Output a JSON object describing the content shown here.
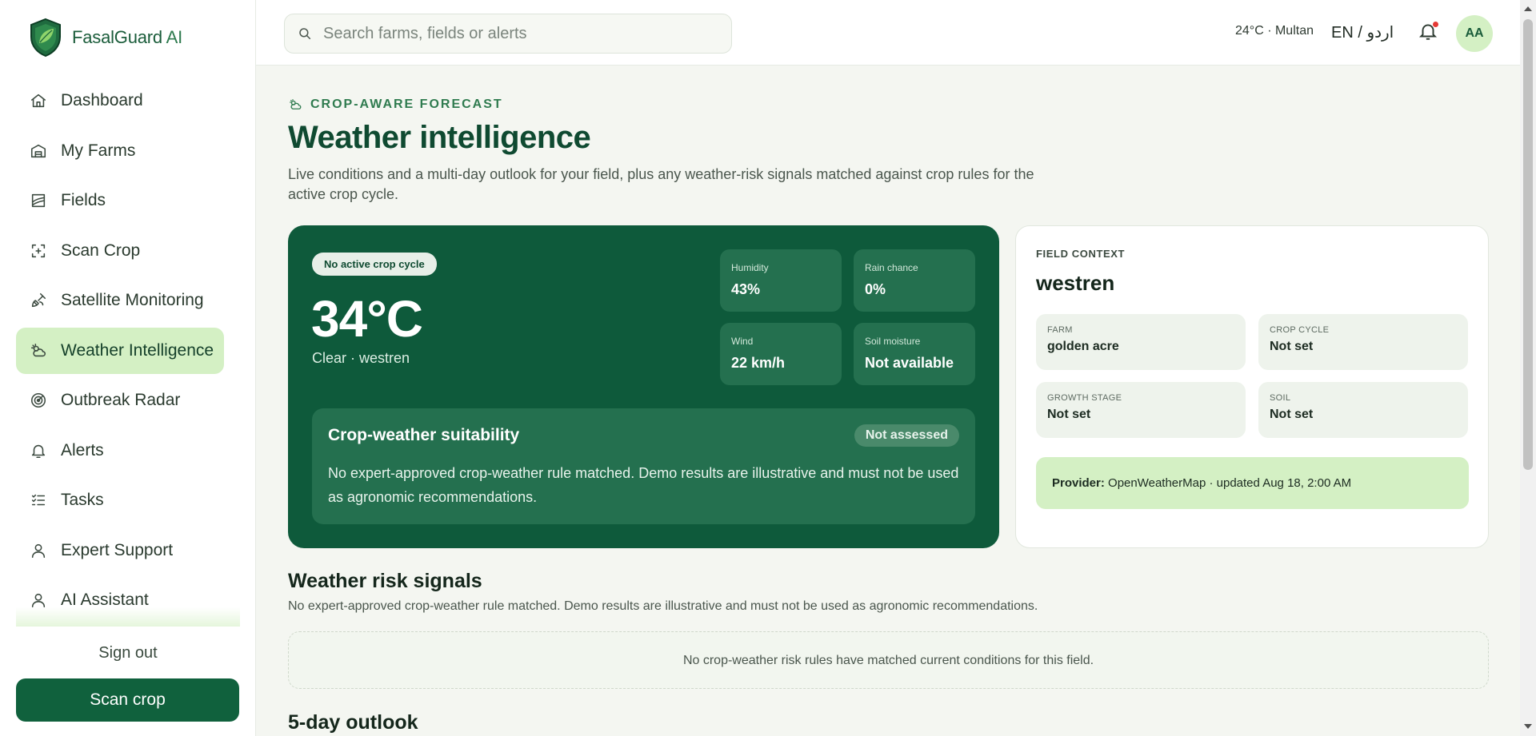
{
  "brand": {
    "name": "FasalGuard",
    "suffix": "AI"
  },
  "sidebar": {
    "items": [
      {
        "label": "Dashboard",
        "icon": "home-icon"
      },
      {
        "label": "My Farms",
        "icon": "barn-icon"
      },
      {
        "label": "Fields",
        "icon": "field-icon"
      },
      {
        "label": "Scan Crop",
        "icon": "scan-icon"
      },
      {
        "label": "Satellite Monitoring",
        "icon": "satellite-icon"
      },
      {
        "label": "Weather Intelligence",
        "icon": "weather-icon",
        "active": true
      },
      {
        "label": "Outbreak Radar",
        "icon": "radar-icon"
      },
      {
        "label": "Alerts",
        "icon": "bell-icon"
      },
      {
        "label": "Tasks",
        "icon": "tasks-icon"
      },
      {
        "label": "Expert Support",
        "icon": "user-icon"
      },
      {
        "label": "AI Assistant",
        "icon": "user-icon"
      }
    ],
    "sign_out": "Sign out",
    "scan_button": "Scan crop"
  },
  "topbar": {
    "search_placeholder": "Search farms, fields or alerts",
    "temp_location": "24°C · Multan",
    "language": "EN / اردو",
    "avatar_initials": "AA"
  },
  "page": {
    "eyebrow": "CROP-AWARE FORECAST",
    "title": "Weather intelligence",
    "description": "Live conditions and a multi-day outlook for your field, plus any weather-risk signals matched against crop rules for the active crop cycle."
  },
  "current": {
    "crop_status": "No active crop cycle",
    "temperature": "34°C",
    "condition": "Clear · westren",
    "metrics": [
      {
        "label": "Humidity",
        "value": "43%"
      },
      {
        "label": "Rain chance",
        "value": "0%"
      },
      {
        "label": "Wind",
        "value": "22 km/h"
      },
      {
        "label": "Soil moisture",
        "value": "Not available"
      }
    ],
    "suitability": {
      "title": "Crop-weather suitability",
      "badge": "Not assessed",
      "text": "No expert-approved crop-weather rule matched. Demo results are illustrative and must not be used as agronomic recommendations."
    }
  },
  "field_context": {
    "eyebrow": "FIELD CONTEXT",
    "name": "westren",
    "cells": [
      {
        "label": "Farm",
        "value": "golden acre"
      },
      {
        "label": "Crop cycle",
        "value": "Not set"
      },
      {
        "label": "Growth stage",
        "value": "Not set"
      },
      {
        "label": "Soil",
        "value": "Not set"
      }
    ],
    "provider_label": "Provider:",
    "provider_text": " OpenWeatherMap · updated Aug 18, 2:00 AM"
  },
  "risk": {
    "title": "Weather risk signals",
    "description": "No expert-approved crop-weather rule matched. Demo results are illustrative and must not be used as agronomic recommendations.",
    "empty": "No crop-weather risk rules have matched current conditions for this field."
  },
  "outlook": {
    "title": "5-day outlook"
  },
  "colors": {
    "brand_dark": "#0e5a3b",
    "accent_light": "#d4f0c4",
    "alert_dot": "#e53935"
  }
}
